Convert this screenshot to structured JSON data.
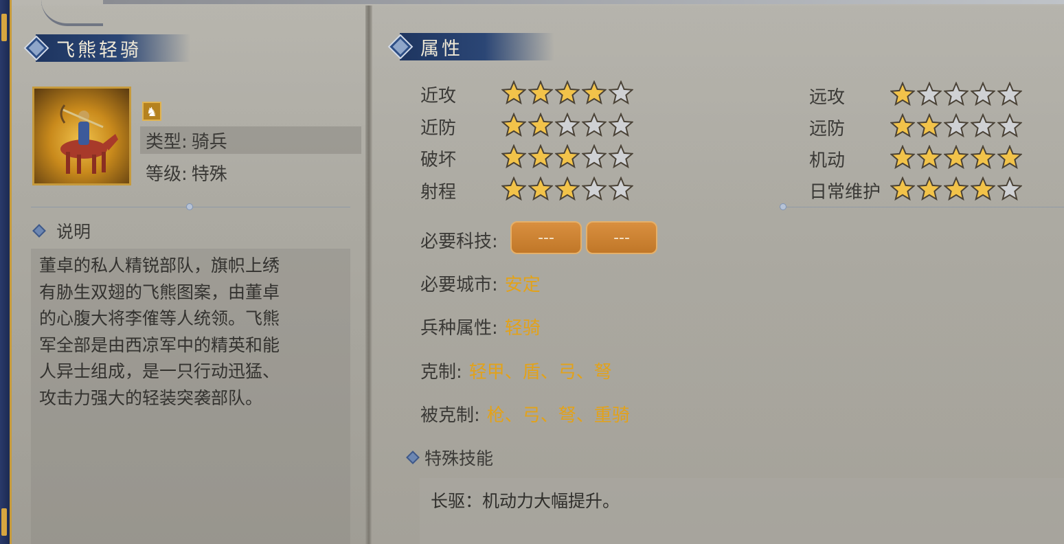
{
  "unit": {
    "name": "飞熊轻骑",
    "type_label": "类型:",
    "type_value": "骑兵",
    "level_label": "等级:",
    "level_value": "特殊",
    "icon": "horse-icon"
  },
  "description": {
    "header": "说明",
    "lines": [
      "董卓的私人精锐部队，旗帜上绣",
      "有胁生双翅的飞熊图案，由董卓",
      "的心腹大将李傕等人统领。飞熊",
      "军全部是由西凉军中的精英和能",
      "人异士组成，是一只行动迅猛、",
      "攻击力强大的轻装突袭部队。"
    ]
  },
  "attributes": {
    "header": "属性",
    "left": [
      {
        "label": "近攻",
        "stars": 4
      },
      {
        "label": "近防",
        "stars": 2
      },
      {
        "label": "破坏",
        "stars": 3
      },
      {
        "label": "射程",
        "stars": 3
      }
    ],
    "right": [
      {
        "label": "远攻",
        "stars": 1
      },
      {
        "label": "远防",
        "stars": 2
      },
      {
        "label": "机动",
        "stars": 5
      },
      {
        "label": "日常维护",
        "stars": 4
      }
    ],
    "max_stars": 5
  },
  "requirements": {
    "tech_label": "必要科技:",
    "tech_slots": [
      "---",
      "---"
    ],
    "city_label": "必要城市:",
    "city_value": "安定",
    "troop_label": "兵种属性:",
    "troop_value": "轻骑",
    "counters_label": "克制:",
    "counters_value": "轻甲、盾、弓、弩",
    "countered_label": "被克制:",
    "countered_value": "枪、弓、弩、重骑"
  },
  "skill": {
    "header": "特殊技能",
    "text": "长驱：机动力大幅提升。"
  },
  "colors": {
    "accent_gold": "#e2a21a",
    "title_bar": "#1e3560",
    "star_filled": "#f2c34a",
    "star_empty": "#cfd1d4"
  }
}
